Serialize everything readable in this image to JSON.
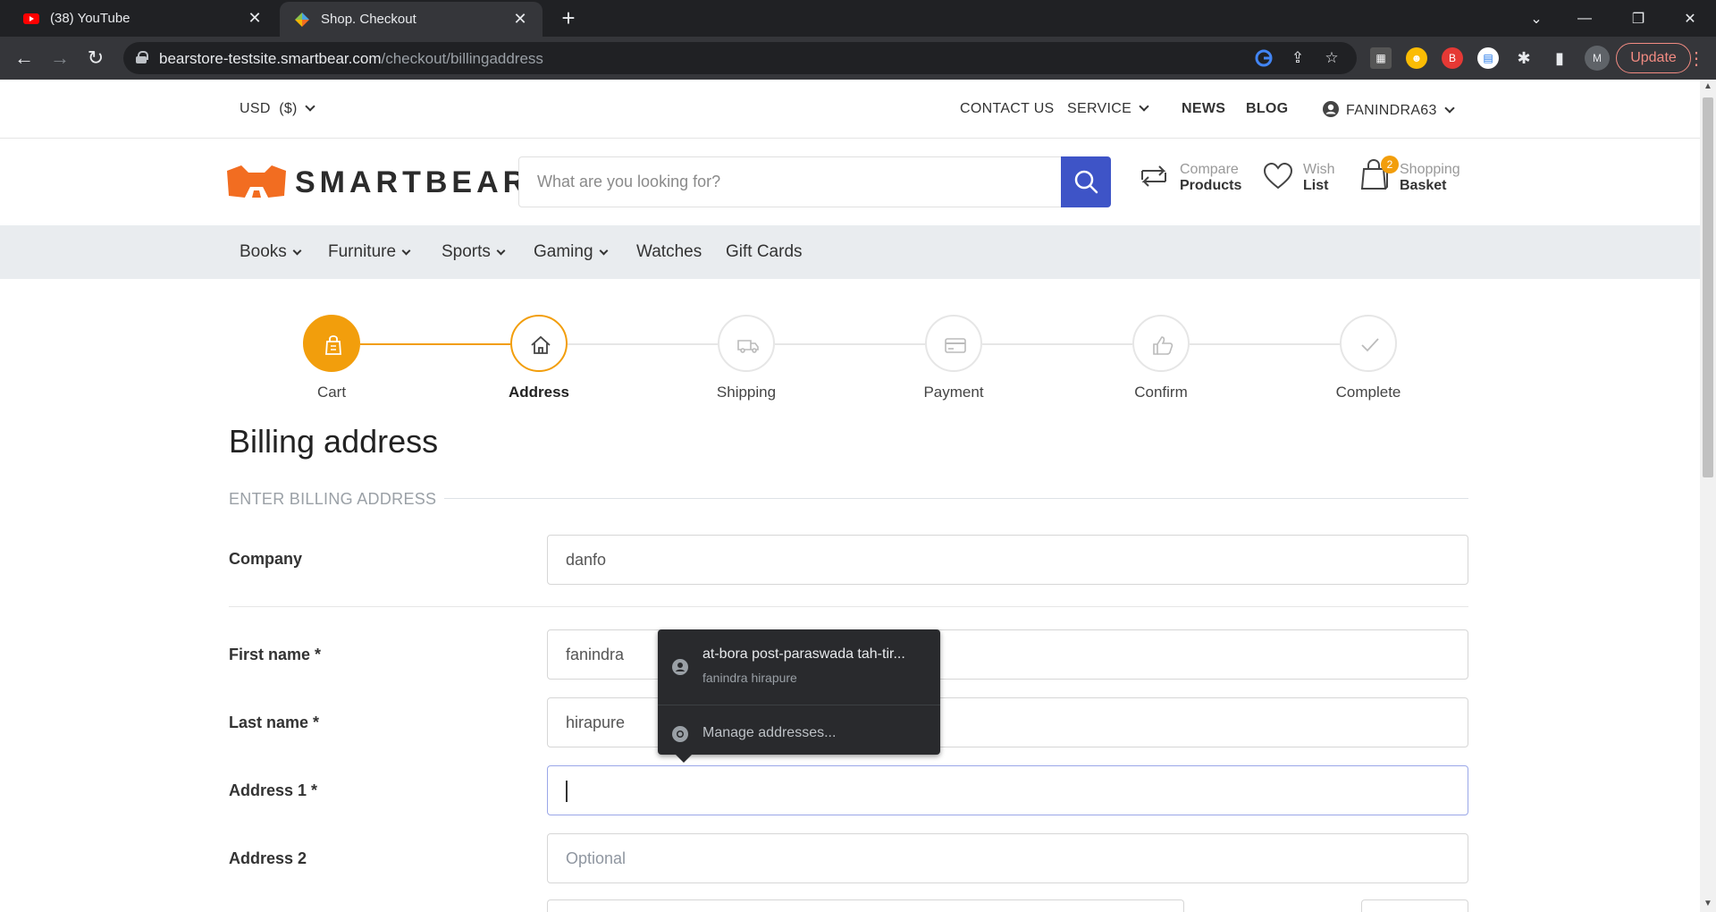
{
  "browser": {
    "tabs": [
      {
        "title": "(38) YouTube",
        "icon": "youtube-icon"
      },
      {
        "title": "Shop. Checkout",
        "icon": "smartbear-favicon"
      }
    ],
    "url_host": "bearstore-testsite.smartbear.com",
    "url_path": "/checkout/billingaddress",
    "profile_initial": "M",
    "update_label": "Update"
  },
  "topbar": {
    "currency": "USD",
    "currency_symbol": "($)",
    "contact": "CONTACT US",
    "service": "SERVICE",
    "news": "NEWS",
    "blog": "BLOG",
    "account": "FANINDRA63"
  },
  "header": {
    "logo": "SMARTBEAR",
    "search_placeholder": "What are you looking for?",
    "compare_top": "Compare",
    "compare_bottom": "Products",
    "wish_top": "Wish",
    "wish_bottom": "List",
    "basket_top": "Shopping",
    "basket_bottom": "Basket",
    "basket_count": "2"
  },
  "categories": [
    "Books",
    "Furniture",
    "Sports",
    "Gaming",
    "Watches",
    "Gift Cards"
  ],
  "steps": [
    {
      "label": "Cart",
      "state": "done"
    },
    {
      "label": "Address",
      "state": "active"
    },
    {
      "label": "Shipping",
      "state": "todo"
    },
    {
      "label": "Payment",
      "state": "todo"
    },
    {
      "label": "Confirm",
      "state": "todo"
    },
    {
      "label": "Complete",
      "state": "todo"
    }
  ],
  "page": {
    "title": "Billing address",
    "section": "ENTER BILLING ADDRESS"
  },
  "form": {
    "company_label": "Company",
    "company_value": "danfo",
    "first_label": "First name *",
    "first_value": "fanindra",
    "last_label": "Last name *",
    "last_value": "hirapure",
    "addr1_label": "Address 1 *",
    "addr1_value": "",
    "addr2_label": "Address 2",
    "addr2_placeholder": "Optional"
  },
  "autofill": {
    "suggestion": "at-bora post-paraswada tah-tir...",
    "suggestion_name": "fanindra hirapure",
    "manage": "Manage addresses..."
  },
  "colors": {
    "accent": "#f29e0c",
    "primary": "#3e54c7",
    "brand_orange": "#f26d21"
  }
}
